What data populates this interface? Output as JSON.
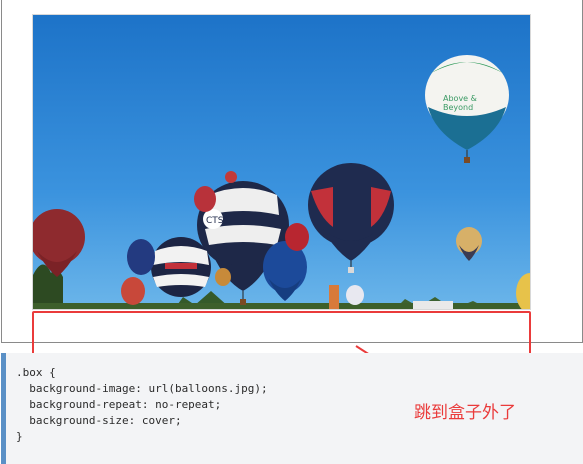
{
  "code": {
    "lines": [
      ".box {",
      "  background-image: url(balloons.jpg);",
      "  background-repeat: no-repeat;",
      "  background-size: cover;",
      "}"
    ]
  },
  "annotation": {
    "text": "跳到盒子外了",
    "color": "#ea3b3b"
  },
  "image": {
    "description_icon": "hot-air-balloons-photo"
  },
  "colors": {
    "highlight": "#ea3b3b",
    "code_bar": "#5a90c6",
    "code_bg": "#f3f4f6"
  }
}
